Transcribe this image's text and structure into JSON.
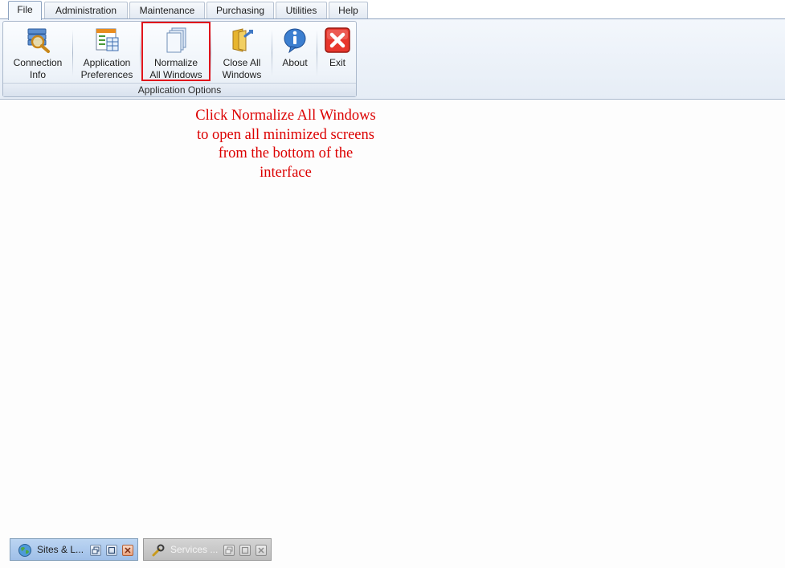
{
  "tabs": [
    {
      "label": "File",
      "active": true
    },
    {
      "label": "Administration",
      "active": false
    },
    {
      "label": "Maintenance",
      "active": false
    },
    {
      "label": "Purchasing",
      "active": false
    },
    {
      "label": "Utilities",
      "active": false
    },
    {
      "label": "Help",
      "active": false
    }
  ],
  "ribbon": {
    "group_label": "Application Options",
    "buttons": [
      {
        "label": "Connection\nInfo",
        "icon": "connection-info-icon"
      },
      {
        "label": "Application\nPreferences",
        "icon": "preferences-icon"
      },
      {
        "label": "Normalize\nAll Windows",
        "icon": "normalize-windows-icon",
        "highlighted": true
      },
      {
        "label": "Close All\nWindows",
        "icon": "close-all-windows-icon"
      },
      {
        "label": "About",
        "icon": "about-icon"
      },
      {
        "label": "Exit",
        "icon": "exit-icon"
      }
    ]
  },
  "annotation": {
    "text": "Click Normalize All Windows\nto open all minimized screens\nfrom the bottom of the\ninterface",
    "color": "#dc0000"
  },
  "minimized_windows": [
    {
      "title": "Sites & L...",
      "icon": "globe-icon",
      "active": true
    },
    {
      "title": "Services ...",
      "icon": "wrench-icon",
      "active": false
    }
  ],
  "colors": {
    "highlight": "#e0141c",
    "active_minimized_bg": "#a9c6ec",
    "inactive_minimized_bg": "#c8c8c8"
  }
}
